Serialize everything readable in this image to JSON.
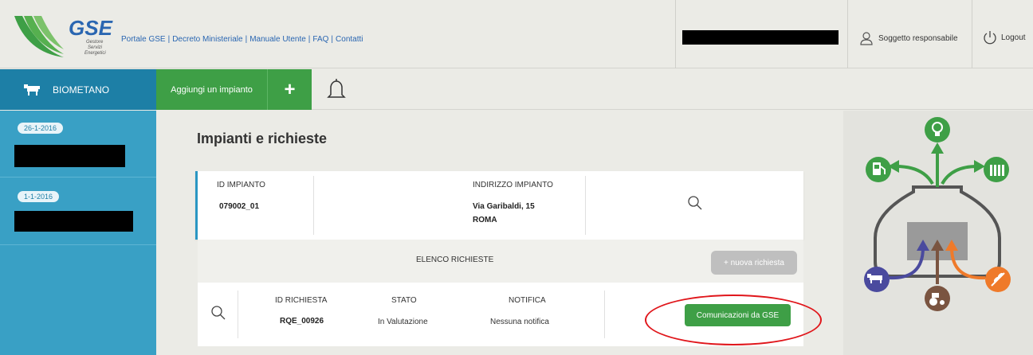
{
  "header": {
    "logo_text": "GSE",
    "logo_subtext": [
      "Gestore",
      "Servizi",
      "Energetici"
    ],
    "links": [
      "Portale GSE",
      "Decreto Ministeriale",
      "Manuale Utente",
      "FAQ",
      "Contatti"
    ],
    "link_separator": "|",
    "user_label": "Soggetto responsabile",
    "logout_label": "Logout"
  },
  "nav": {
    "section_label": "BIOMETANO",
    "add_label": "Aggiungi un impianto",
    "plus_label": "+"
  },
  "sidebar": {
    "items": [
      {
        "date": "26-1-2016"
      },
      {
        "date": "1-1-2016"
      }
    ]
  },
  "main": {
    "title": "Impianti e richieste",
    "impianto": {
      "id_label": "ID IMPIANTO",
      "id_value": "079002_01",
      "address_label": "INDIRIZZO IMPIANTO",
      "address_line1": "Via Garibaldi, 15",
      "address_line2": "ROMA"
    },
    "requests": {
      "list_label": "ELENCO RICHIESTE",
      "new_request_label": "+ nuova richiesta",
      "row": {
        "id_label": "ID RICHIESTA",
        "id_value": "RQE_00926",
        "status_label": "STATO",
        "status_value": "In Valutazione",
        "notification_label": "NOTIFICA",
        "notification_value": "Nessuna notifica",
        "action_label": "Comunicazioni da GSE"
      }
    }
  },
  "colors": {
    "brand_blue": "#1d7fa6",
    "sidebar_blue": "#39a0c5",
    "green": "#3e9f46",
    "highlight_red": "#e0161b"
  }
}
